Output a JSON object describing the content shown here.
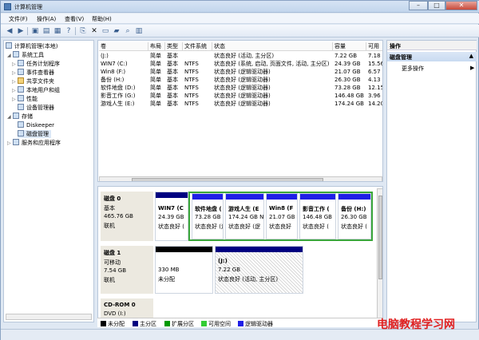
{
  "window": {
    "title": "计算机管理",
    "controls": {
      "minimize": "–",
      "maximize": "□",
      "close": "✕"
    }
  },
  "menu": [
    "文件(F)",
    "操作(A)",
    "查看(V)",
    "帮助(H)"
  ],
  "toolbar_icons": [
    "back-icon",
    "forward-icon",
    "up-folder-icon",
    "show-tree-icon",
    "properties-icon",
    "help-icon",
    "export-icon",
    "delete-icon",
    "open-icon",
    "save-icon",
    "search-icon",
    "refresh-icon"
  ],
  "tree": [
    {
      "label": "计算机管理(本地)",
      "level": 0,
      "arrow": ""
    },
    {
      "label": "系统工具",
      "level": 1,
      "arrow": "◢"
    },
    {
      "label": "任务计划程序",
      "level": 2,
      "arrow": "▷"
    },
    {
      "label": "事件查看器",
      "level": 2,
      "arrow": "▷"
    },
    {
      "label": "共享文件夹",
      "level": 2,
      "arrow": "▷"
    },
    {
      "label": "本地用户和组",
      "level": 2,
      "arrow": "▷"
    },
    {
      "label": "性能",
      "level": 2,
      "arrow": "▷"
    },
    {
      "label": "设备管理器",
      "level": 2,
      "arrow": ""
    },
    {
      "label": "存储",
      "level": 1,
      "arrow": "◢"
    },
    {
      "label": "Diskeeper",
      "level": 2,
      "arrow": ""
    },
    {
      "label": "磁盘管理",
      "level": 2,
      "arrow": "",
      "selected": true
    },
    {
      "label": "服务和应用程序",
      "level": 1,
      "arrow": "▷"
    }
  ],
  "volume_headers": [
    "卷",
    "布局",
    "类型",
    "文件系统",
    "状态",
    "容量",
    "可用"
  ],
  "volumes": [
    [
      "(J:)",
      "简单",
      "基本",
      "",
      "状态良好 (活动, 主分区)",
      "7.22 GB",
      "7.18"
    ],
    [
      "WIN7 (C:)",
      "简单",
      "基本",
      "NTFS",
      "状态良好 (系统, 启动, 页面文件, 活动, 主分区)",
      "24.39 GB",
      "15.56"
    ],
    [
      "Win8 (F:)",
      "简单",
      "基本",
      "NTFS",
      "状态良好 (逻辑驱动器)",
      "21.07 GB",
      "6.57"
    ],
    [
      "备份 (H:)",
      "简单",
      "基本",
      "NTFS",
      "状态良好 (逻辑驱动器)",
      "26.30 GB",
      "4.13"
    ],
    [
      "软件地盘 (D:)",
      "简单",
      "基本",
      "NTFS",
      "状态良好 (逻辑驱动器)",
      "73.28 GB",
      "12.15"
    ],
    [
      "影音工作 (G:)",
      "简单",
      "基本",
      "NTFS",
      "状态良好 (逻辑驱动器)",
      "146.48 GB",
      "3.96"
    ],
    [
      "游戏人生 (E:)",
      "简单",
      "基本",
      "NTFS",
      "状态良好 (逻辑驱动器)",
      "174.24 GB",
      "14.20"
    ]
  ],
  "disks": [
    {
      "name": "磁盘 0",
      "lines": [
        "基本",
        "465.76 GB",
        "联机"
      ],
      "partitions": [
        {
          "title": "WIN7 (C",
          "size": "24.39 GB",
          "status": "状态良好 (",
          "color": "#000080"
        },
        {
          "title": "软件地盘 (",
          "size": "73.28 GB N",
          "status": "状态良好 (逻",
          "color": "#1f1fe6"
        },
        {
          "title": "游戏人生 (E",
          "size": "174.24 GB N",
          "status": "状态良好 (逻",
          "color": "#1f1fe6"
        },
        {
          "title": "Win8 (F",
          "size": "21.07 GB",
          "status": "状态良好",
          "color": "#1f1fe6"
        },
        {
          "title": "影音工作 (",
          "size": "146.48 GB",
          "status": "状态良好 (",
          "color": "#1f1fe6"
        },
        {
          "title": "备份 (H:)",
          "size": "26.30 GB",
          "status": "状态良好 (",
          "color": "#1f1fe6"
        }
      ]
    },
    {
      "name": "磁盘 1",
      "lines": [
        "可移动",
        "7.54 GB",
        "联机"
      ],
      "partitions": [
        {
          "title": "",
          "size": "330 MB",
          "status": "未分配",
          "color": "#000000"
        },
        {
          "title": "(J:)",
          "size": "7.22 GB",
          "status": "状态良好 (活动, 主分区)",
          "color": "#000080"
        }
      ]
    },
    {
      "name": "CD-ROM 0",
      "lines": [
        "DVD (I:)"
      ]
    }
  ],
  "legend": [
    {
      "label": "未分配",
      "color": "#000000"
    },
    {
      "label": "主分区",
      "color": "#000080"
    },
    {
      "label": "扩展分区",
      "color": "#009900"
    },
    {
      "label": "可用空间",
      "color": "#33cc33"
    },
    {
      "label": "逻辑驱动器",
      "color": "#1f1fe6"
    }
  ],
  "actions": {
    "header": "操作",
    "selected": "磁盘管理",
    "more": "更多操作"
  },
  "watermark": "电脑教程学习网"
}
